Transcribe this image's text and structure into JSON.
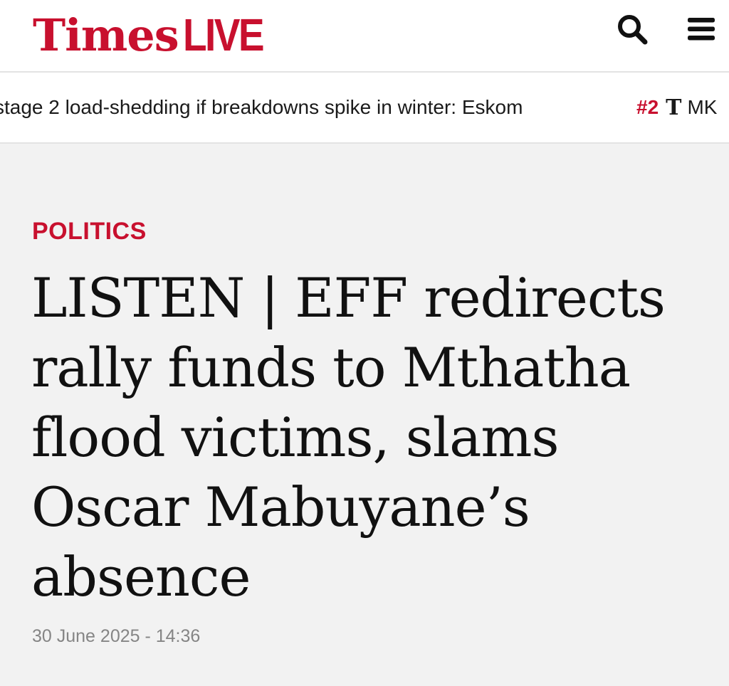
{
  "header": {
    "logo_times": "Times",
    "logo_live": "LIVE",
    "search_icon": "search-icon",
    "menu_icon": "hamburger-menu-icon"
  },
  "ticker": {
    "items": [
      {
        "text": "stage 2 load-shedding if breakdowns spike in winter: Eskom"
      },
      {
        "number": "#2",
        "logo": "T",
        "text": "MK"
      }
    ]
  },
  "article": {
    "category": "POLITICS",
    "headline": "LISTEN | EFF redirects rally funds to Mthatha flood victims, slams Oscar Mabuyane’s absence",
    "date": "30 June 2025 - 14:36"
  },
  "colors": {
    "brand_red": "#c8102e",
    "background": "#f2f2f2",
    "header_background": "#ffffff",
    "date_gray": "#858585"
  }
}
